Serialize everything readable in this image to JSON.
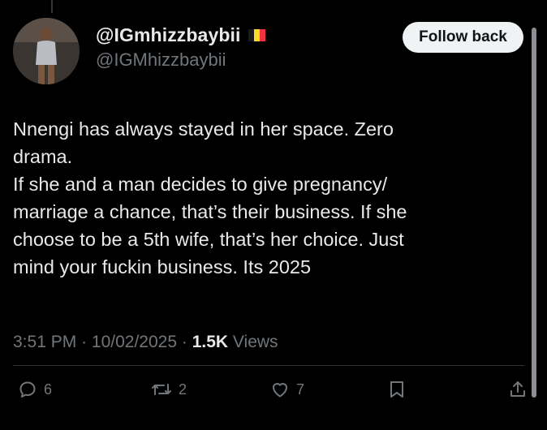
{
  "tweet": {
    "display_name": "@IGmhizzbaybii",
    "handle": "@IGMhizzbaybii",
    "flag_colors": [
      "#000000",
      "#FDDA24",
      "#EF3340"
    ],
    "follow_button_label": "Follow back",
    "text_lines": [
      "Nnengi has always stayed in her space. Zero",
      "drama.",
      "If she and a man decides to give pregnancy/",
      "marriage a chance, that’s their business. If she",
      "choose to be a 5th wife, that’s her choice. Just",
      "mind your fuckin business. Its 2025"
    ],
    "time": "3:51 PM",
    "date": "10/02/2025",
    "separator": "·",
    "views_count": "1.5K",
    "views_label": "Views"
  },
  "actions": {
    "replies": {
      "icon": "reply-icon",
      "count": "6"
    },
    "reposts": {
      "icon": "repost-icon",
      "count": "2"
    },
    "likes": {
      "icon": "like-icon",
      "count": "7"
    },
    "bookmark": {
      "icon": "bookmark-icon"
    },
    "share": {
      "icon": "share-icon"
    }
  },
  "colors": {
    "background": "#000000",
    "text_primary": "#e7e9ea",
    "text_secondary": "#71767b",
    "button_bg": "#eff3f4"
  }
}
